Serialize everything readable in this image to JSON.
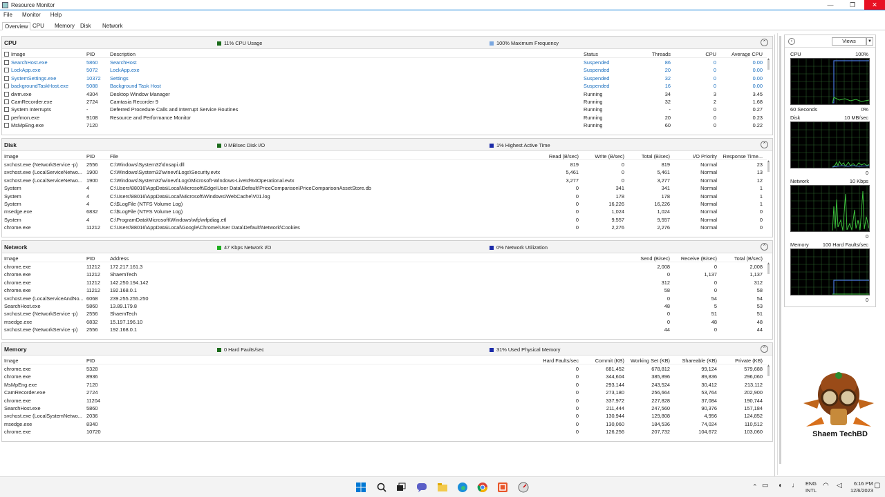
{
  "window": {
    "title": "Resource Monitor",
    "minimize": "—",
    "maximize": "❐",
    "close": "✕"
  },
  "menu": [
    "File",
    "Monitor",
    "Help"
  ],
  "tabs": [
    "Overview",
    "CPU",
    "Memory",
    "Disk",
    "Network"
  ],
  "cpu": {
    "title": "CPU",
    "stat1": "11% CPU Usage",
    "stat2": "100% Maximum Frequency",
    "color1": "#1b6b1b",
    "color2": "#7aa7e0",
    "headers": [
      "Image",
      "PID",
      "Description",
      "Status",
      "Threads",
      "CPU",
      "Average CPU"
    ],
    "rows": [
      [
        "SearchHost.exe",
        "5860",
        "SearchHost",
        "Suspended",
        "86",
        "0",
        "0.00"
      ],
      [
        "LockApp.exe",
        "5072",
        "LockApp.exe",
        "Suspended",
        "20",
        "0",
        "0.00"
      ],
      [
        "SystemSettings.exe",
        "10372",
        "Settings",
        "Suspended",
        "32",
        "0",
        "0.00"
      ],
      [
        "backgroundTaskHost.exe",
        "5088",
        "Background Task Host",
        "Suspended",
        "16",
        "0",
        "0.00"
      ],
      [
        "dwm.exe",
        "4304",
        "Desktop Window Manager",
        "Running",
        "34",
        "3",
        "3.45"
      ],
      [
        "CamRecorder.exe",
        "2724",
        "Camtasia Recorder 9",
        "Running",
        "32",
        "2",
        "1.68"
      ],
      [
        "System Interrupts",
        "-",
        "Deferred Procedure Calls and Interrupt Service Routines",
        "Running",
        "-",
        "0",
        "0.27"
      ],
      [
        "perfmon.exe",
        "9108",
        "Resource and Performance Monitor",
        "Running",
        "20",
        "0",
        "0.23"
      ],
      [
        "MsMpEng.exe",
        "7120",
        "",
        "Running",
        "60",
        "0",
        "0.22"
      ]
    ]
  },
  "disk": {
    "title": "Disk",
    "stat1": "0 MB/sec Disk I/O",
    "stat2": "1% Highest Active Time",
    "color1": "#1b6b1b",
    "color2": "#1a2aa8",
    "headers": [
      "Image",
      "PID",
      "File",
      "Read (B/sec)",
      "Write (B/sec)",
      "Total (B/sec)",
      "I/O Priority",
      "Response Time..."
    ],
    "rows": [
      [
        "svchost.exe (NetworkService -p)",
        "2556",
        "C:\\Windows\\System32\\dnsapi.dll",
        "819",
        "0",
        "819",
        "Normal",
        "23"
      ],
      [
        "svchost.exe (LocalServiceNetwo...",
        "1900",
        "C:\\Windows\\System32\\winevt\\Logs\\Security.evtx",
        "5,461",
        "0",
        "5,461",
        "Normal",
        "13"
      ],
      [
        "svchost.exe (LocalServiceNetwo...",
        "1900",
        "C:\\Windows\\System32\\winevt\\Logs\\Microsoft-Windows-LiveId%4Operational.evtx",
        "3,277",
        "0",
        "3,277",
        "Normal",
        "12"
      ],
      [
        "System",
        "4",
        "C:\\Users\\88016\\AppData\\Local\\Microsoft\\Edge\\User Data\\Default\\PriceComparison\\PriceComparisonAssetStore.db",
        "0",
        "341",
        "341",
        "Normal",
        "1"
      ],
      [
        "System",
        "4",
        "C:\\Users\\88016\\AppData\\Local\\Microsoft\\Windows\\WebCache\\V01.log",
        "0",
        "178",
        "178",
        "Normal",
        "1"
      ],
      [
        "System",
        "4",
        "C:\\$LogFile (NTFS Volume Log)",
        "0",
        "16,226",
        "16,226",
        "Normal",
        "1"
      ],
      [
        "msedge.exe",
        "6832",
        "C:\\$LogFile (NTFS Volume Log)",
        "0",
        "1,024",
        "1,024",
        "Normal",
        "0"
      ],
      [
        "System",
        "4",
        "C:\\ProgramData\\Microsoft\\Windows\\wfp\\wfpdiag.etl",
        "0",
        "9,557",
        "9,557",
        "Normal",
        "0"
      ],
      [
        "chrome.exe",
        "11212",
        "C:\\Users\\88016\\AppData\\Local\\Google\\Chrome\\User Data\\Default\\Network\\Cookies",
        "0",
        "2,276",
        "2,276",
        "Normal",
        "0"
      ]
    ]
  },
  "network": {
    "title": "Network",
    "stat1": "47 Kbps Network I/O",
    "stat2": "0% Network Utilization",
    "color1": "#1fae1f",
    "color2": "#1a2aa8",
    "headers": [
      "Image",
      "PID",
      "Address",
      "Send (B/sec)",
      "Receive (B/sec)",
      "Total (B/sec)"
    ],
    "rows": [
      [
        "chrome.exe",
        "11212",
        "172.217.161.3",
        "2,008",
        "0",
        "2,008"
      ],
      [
        "chrome.exe",
        "11212",
        "ShaemTech",
        "0",
        "1,137",
        "1,137"
      ],
      [
        "chrome.exe",
        "11212",
        "142.250.194.142",
        "312",
        "0",
        "312"
      ],
      [
        "chrome.exe",
        "11212",
        "192.168.0.1",
        "58",
        "0",
        "58"
      ],
      [
        "svchost.exe (LocalServiceAndNo...",
        "6068",
        "239.255.255.250",
        "0",
        "54",
        "54"
      ],
      [
        "SearchHost.exe",
        "5860",
        "13.89.179.8",
        "48",
        "5",
        "53"
      ],
      [
        "svchost.exe (NetworkService -p)",
        "2556",
        "ShaemTech",
        "0",
        "51",
        "51"
      ],
      [
        "msedge.exe",
        "6832",
        "15.197.196.10",
        "0",
        "48",
        "48"
      ],
      [
        "svchost.exe (NetworkService -p)",
        "2556",
        "192.168.0.1",
        "44",
        "0",
        "44"
      ]
    ]
  },
  "memory": {
    "title": "Memory",
    "stat1": "0 Hard Faults/sec",
    "stat2": "31% Used Physical Memory",
    "color1": "#1b6b1b",
    "color2": "#1a2aa8",
    "headers": [
      "Image",
      "PID",
      "Hard Faults/sec",
      "Commit (KB)",
      "Working Set (KB)",
      "Shareable (KB)",
      "Private (KB)"
    ],
    "rows": [
      [
        "chrome.exe",
        "5328",
        "0",
        "681,452",
        "678,812",
        "99,124",
        "579,688"
      ],
      [
        "chrome.exe",
        "8936",
        "0",
        "344,604",
        "385,896",
        "89,836",
        "296,060"
      ],
      [
        "MsMpEng.exe",
        "7120",
        "0",
        "293,144",
        "243,524",
        "30,412",
        "213,112"
      ],
      [
        "CamRecorder.exe",
        "2724",
        "0",
        "273,180",
        "256,664",
        "53,764",
        "202,900"
      ],
      [
        "chrome.exe",
        "11204",
        "0",
        "337,972",
        "227,828",
        "37,084",
        "190,744"
      ],
      [
        "SearchHost.exe",
        "5860",
        "0",
        "211,444",
        "247,560",
        "90,376",
        "157,184"
      ],
      [
        "svchost.exe (LocalSystemNetwo...",
        "2036",
        "0",
        "130,944",
        "129,808",
        "4,956",
        "124,852"
      ],
      [
        "msedge.exe",
        "8340",
        "0",
        "130,060",
        "184,536",
        "74,024",
        "110,512"
      ],
      [
        "chrome.exe",
        "10720",
        "0",
        "126,256",
        "207,732",
        "104,672",
        "103,060"
      ]
    ]
  },
  "right_panel": {
    "views_label": "Views",
    "graphs": [
      {
        "name": "CPU",
        "max": "100%",
        "min": "0%",
        "footer_left": "60 Seconds",
        "trace": "cpu"
      },
      {
        "name": "Disk",
        "max": "10 MB/sec",
        "min": "0",
        "footer_left": "",
        "trace": "disk"
      },
      {
        "name": "Network",
        "max": "10 Kbps",
        "min": "0",
        "footer_left": "",
        "trace": "network"
      },
      {
        "name": "Memory",
        "max": "100 Hard Faults/sec",
        "min": "0",
        "footer_left": "",
        "trace": "memory"
      }
    ]
  },
  "watermark": {
    "text": "Shaem TechBD"
  },
  "taskbar": {
    "lang_top": "ENG",
    "lang_bottom": "INTL",
    "time": "6:16 PM",
    "date": "12/6/2023"
  }
}
